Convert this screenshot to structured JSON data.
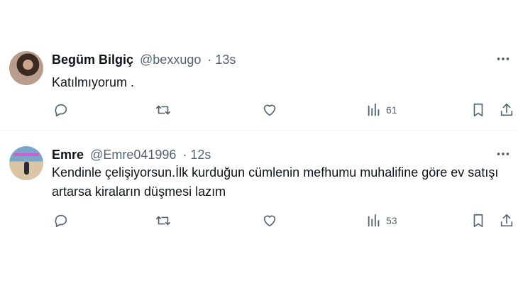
{
  "tweets": [
    {
      "name": "Begüm Bilgiç",
      "handle": "@bexxugo",
      "time": "· 13s",
      "text": "Katılmıyorum .",
      "views": "61",
      "more": "···"
    },
    {
      "name": "Emre",
      "handle": "@Emre041996",
      "time": "· 12s",
      "text": "Kendinle çelişiyorsun.İlk kurduğun cümlenin mefhumu muhalifine göre ev satışı artarsa kiraların düşmesi lazım",
      "views": "53",
      "more": "···"
    }
  ],
  "icons": {
    "reply": "reply-icon",
    "retweet": "retweet-icon",
    "like": "heart-icon",
    "views": "views-chart-icon",
    "bookmark": "bookmark-icon",
    "share": "share-icon",
    "more": "more-icon"
  },
  "colors": {
    "text": "#0f1419",
    "muted": "#536471",
    "divider": "#eff3f4"
  }
}
